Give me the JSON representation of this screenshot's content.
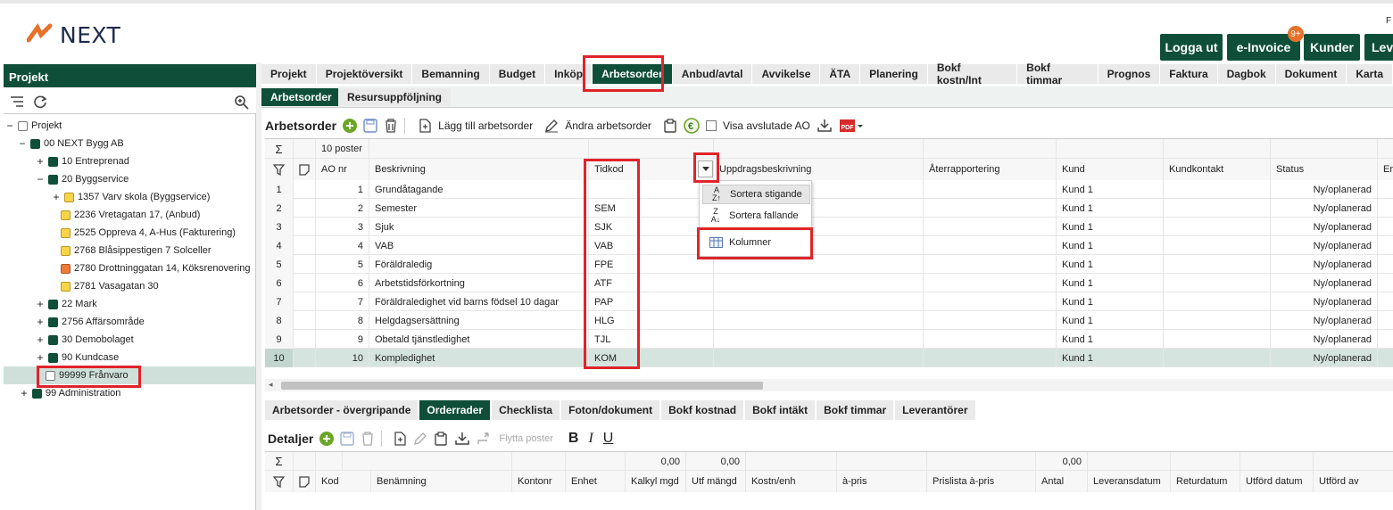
{
  "brand": {
    "logo_text": "NEXT",
    "accent": "#0f4f3a",
    "highlight": "#e0242a"
  },
  "header": {
    "top_right_char": "F",
    "buttons": [
      "Logga ut",
      "e-Invoice",
      "Kunder",
      "Lev"
    ],
    "badge": "9+"
  },
  "left": {
    "title": "Projekt",
    "tree": [
      {
        "label": "Projekt",
        "pm": "−",
        "color": "w"
      },
      {
        "label": "00 NEXT Bygg AB",
        "pm": "−",
        "color": "g"
      },
      {
        "label": "10 Entreprenad",
        "pm": "+",
        "color": "g"
      },
      {
        "label": "20 Byggservice",
        "pm": "−",
        "color": "g"
      },
      {
        "label": "1357 Varv skola (Byggservice)",
        "pm": "+",
        "color": "y"
      },
      {
        "label": "2236 Vretagatan 17, (Anbud)",
        "pm": "",
        "color": "y"
      },
      {
        "label": "2525 Oppreva 4, A-Hus (Fakturering)",
        "pm": "",
        "color": "y"
      },
      {
        "label": "2768 Blåsippestigen 7 Solceller",
        "pm": "",
        "color": "y"
      },
      {
        "label": "2780 Drottninggatan 14, Köksrenovering",
        "pm": "",
        "color": "o"
      },
      {
        "label": "2781 Vasagatan 30",
        "pm": "",
        "color": "y"
      },
      {
        "label": "22 Mark",
        "pm": "+",
        "color": "g"
      },
      {
        "label": "2756 Affärsområde",
        "pm": "+",
        "color": "g"
      },
      {
        "label": "30 Demobolaget",
        "pm": "+",
        "color": "g"
      },
      {
        "label": "90 Kundcase",
        "pm": "+",
        "color": "g"
      },
      {
        "label": "99999 Frånvaro",
        "pm": "",
        "color": "w"
      },
      {
        "label": "99 Administration",
        "pm": "+",
        "color": "g"
      }
    ]
  },
  "main_tabs": [
    "Projekt",
    "Projektöversikt",
    "Bemanning",
    "Budget",
    "Inköp",
    "Arbetsorder",
    "Anbud/avtal",
    "Avvikelse",
    "ÄTA",
    "Planering",
    "Bokf kostn/Int",
    "Bokf timmar",
    "Prognos",
    "Faktura",
    "Dagbok",
    "Dokument",
    "Karta"
  ],
  "sub_tabs": [
    "Arbetsorder",
    "Resursuppföljning"
  ],
  "toolbar": {
    "title": "Arbetsorder",
    "add_label": "Lägg till arbetsorder",
    "edit_label": "Ändra arbetsorder",
    "show_closed_label": "Visa avslutade AO"
  },
  "grid": {
    "sigma": "Σ",
    "count": "10 poster",
    "columns": [
      "AO nr",
      "Beskrivning",
      "Tidkod",
      "Uppdragsbeskrivning",
      "Återrapportering",
      "Kund",
      "Kundkontakt",
      "Status",
      "Er"
    ],
    "rows": [
      {
        "n": "1",
        "ao": "1",
        "desc": "Grundåtagande",
        "tid": "",
        "kund": "Kund 1",
        "status": "Ny/oplanerad"
      },
      {
        "n": "2",
        "ao": "2",
        "desc": "Semester",
        "tid": "SEM",
        "kund": "Kund 1",
        "status": "Ny/oplanerad"
      },
      {
        "n": "3",
        "ao": "3",
        "desc": "Sjuk",
        "tid": "SJK",
        "kund": "Kund 1",
        "status": "Ny/oplanerad"
      },
      {
        "n": "4",
        "ao": "4",
        "desc": "VAB",
        "tid": "VAB",
        "kund": "Kund 1",
        "status": "Ny/oplanerad"
      },
      {
        "n": "5",
        "ao": "5",
        "desc": "Föräldraledig",
        "tid": "FPE",
        "kund": "Kund 1",
        "status": "Ny/oplanerad"
      },
      {
        "n": "6",
        "ao": "6",
        "desc": "Arbetstidsförkortning",
        "tid": "ATF",
        "kund": "Kund 1",
        "status": "Ny/oplanerad"
      },
      {
        "n": "7",
        "ao": "7",
        "desc": "Föräldraledighet vid barns födsel 10 dagar",
        "tid": "PAP",
        "kund": "Kund 1",
        "status": "Ny/oplanerad"
      },
      {
        "n": "8",
        "ao": "8",
        "desc": "Helgdagsersättning",
        "tid": "HLG",
        "kund": "Kund 1",
        "status": "Ny/oplanerad"
      },
      {
        "n": "9",
        "ao": "9",
        "desc": "Obetald tjänstledighet",
        "tid": "TJL",
        "kund": "Kund 1",
        "status": "Ny/oplanerad"
      },
      {
        "n": "10",
        "ao": "10",
        "desc": "Kompledighet",
        "tid": "KOM",
        "kund": "Kund 1",
        "status": "Ny/oplanerad"
      }
    ]
  },
  "dropdown": {
    "items": [
      "Sortera stigande",
      "Sortera fallande",
      "Kolumner"
    ]
  },
  "bottom_tabs": [
    "Arbetsorder - övergripande",
    "Orderrader",
    "Checklista",
    "Foton/dokument",
    "Bokf kostnad",
    "Bokf intäkt",
    "Bokf timmar",
    "Leverantörer"
  ],
  "details": {
    "title": "Detaljer",
    "move_label": "Flytta poster",
    "sums": [
      "0,00",
      "0,00",
      "0,00"
    ],
    "columns": [
      "Kod",
      "Benämning",
      "Kontonr",
      "Enhet",
      "Kalkyl mgd",
      "Utf mängd",
      "Kostn/enh",
      "à-pris",
      "Prislista à-pris",
      "Antal",
      "Leveransdatum",
      "Returdatum",
      "Utförd datum",
      "Utförd av"
    ]
  }
}
